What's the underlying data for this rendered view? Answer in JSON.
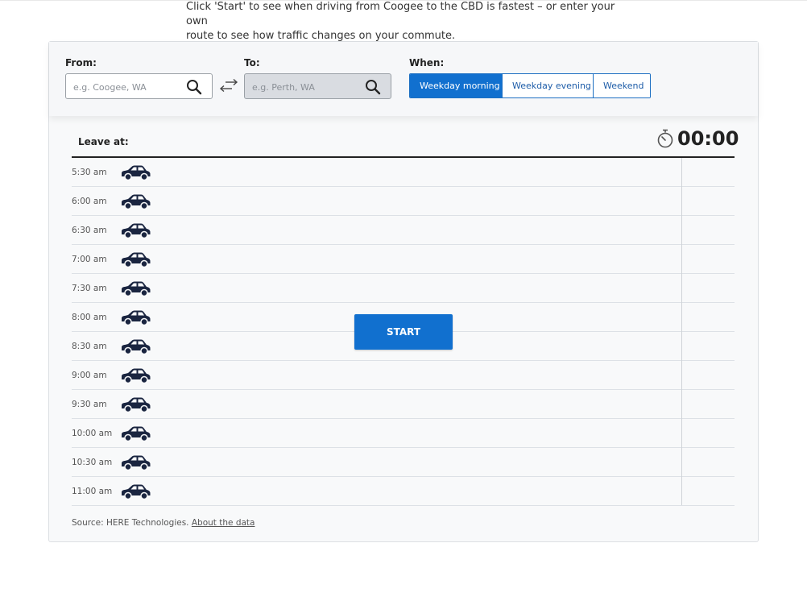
{
  "intro": {
    "line1": "Click 'Start' to see when driving from Coogee to the CBD is fastest – or enter your own",
    "line2": "route to see how traffic changes on your commute."
  },
  "controls": {
    "from_label": "From:",
    "from_placeholder": "e.g. Coogee, WA",
    "to_label": "To:",
    "to_placeholder": "e.g. Perth, WA",
    "when_label": "When:",
    "when_options": [
      "Weekday morning",
      "Weekday evening",
      "Weekend"
    ],
    "when_selected": "Weekday morning"
  },
  "table": {
    "leave_label": "Leave at:",
    "timer": "00:00",
    "times": [
      "5:30 am",
      "6:00 am",
      "6:30 am",
      "7:00 am",
      "7:30 am",
      "8:00 am",
      "8:30 am",
      "9:00 am",
      "9:30 am",
      "10:00 am",
      "10:30 am",
      "11:00 am"
    ]
  },
  "start_label": "START",
  "source": {
    "text": "Source: HERE Technologies.",
    "link": "About the data"
  },
  "colors": {
    "accent": "#1170cf",
    "car": "#1a2540"
  }
}
